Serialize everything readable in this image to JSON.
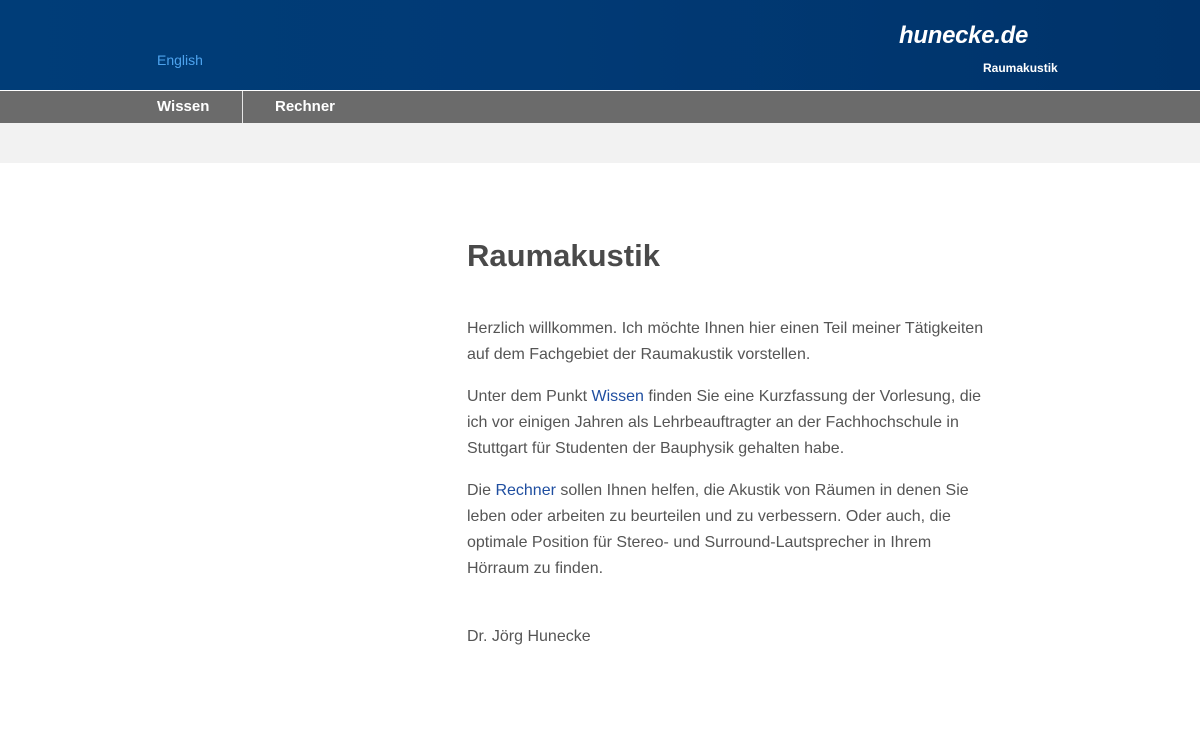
{
  "header": {
    "language_link": "English",
    "logo": "hunecke.de",
    "logo_subtitle": "Raumakustik"
  },
  "nav": {
    "items": [
      {
        "label": "Wissen"
      },
      {
        "label": "Rechner"
      }
    ]
  },
  "main": {
    "title": "Raumakustik",
    "intro": "Herzlich willkommen. Ich möchte Ihnen hier einen Teil meiner Tätigkeiten auf dem Fachgebiet der Raumakustik vorstellen.",
    "p2_before": "Unter dem Punkt ",
    "p2_link": "Wissen",
    "p2_after": " finden Sie eine Kurzfassung der Vorlesung, die ich vor einigen Jahren als Lehrbeauftragter an der Fachhochschule in Stuttgart für Studenten der Bauphysik gehalten habe.",
    "p3_before": "Die ",
    "p3_link": "Rechner",
    "p3_after": " sollen Ihnen helfen, die Akustik von Räumen in denen Sie leben oder arbeiten zu beurteilen und zu verbessern. Oder auch, die optimale Position für Stereo- und Surround-Lautsprecher in Ihrem Hörraum zu finden.",
    "signature": "Dr. Jörg Hunecke"
  },
  "colors": {
    "header_bg": "#003d78",
    "nav_bg": "#6b6b6b",
    "link": "#1f4ea0",
    "lang_link": "#4da3ee"
  }
}
